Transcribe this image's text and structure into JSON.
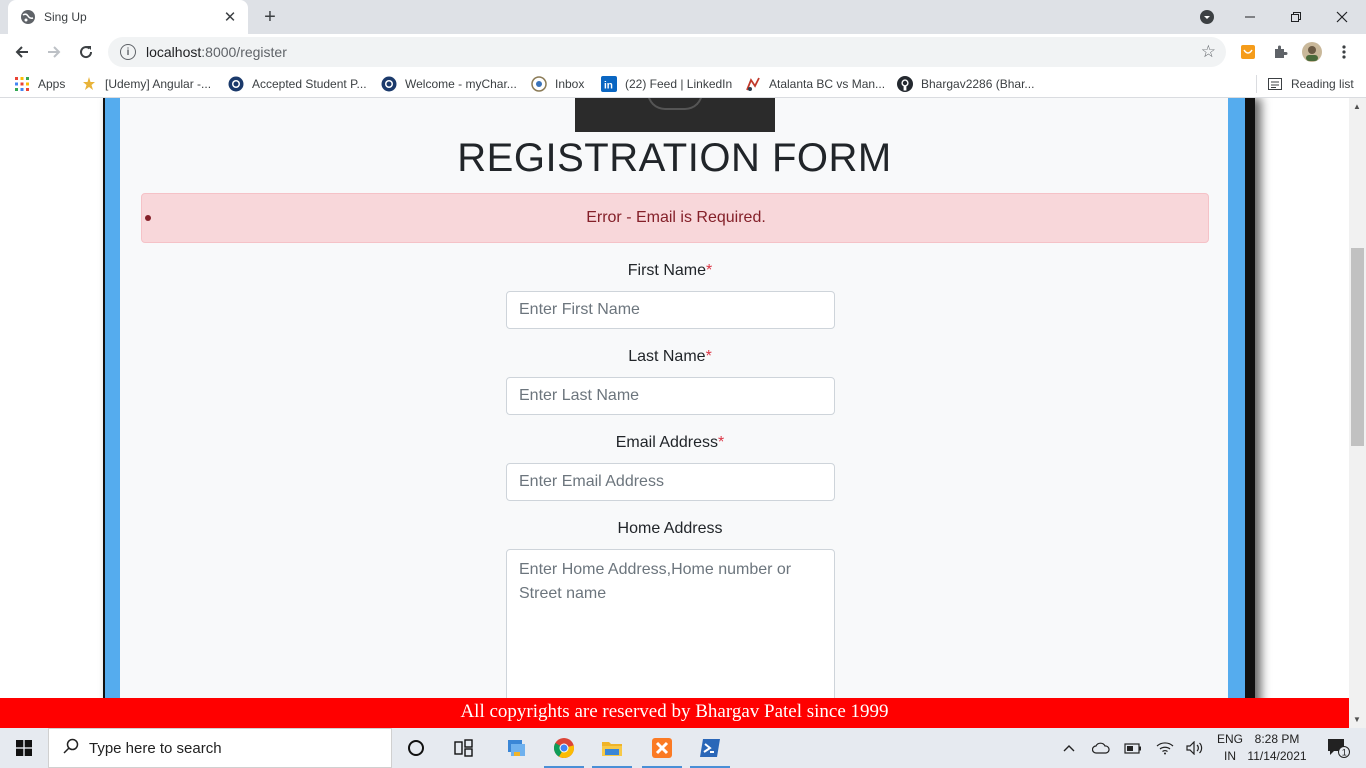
{
  "browser": {
    "tab_title": "Sing Up",
    "url_host": "localhost",
    "url_path": ":8000/register"
  },
  "bookmarks": [
    {
      "label": "Apps"
    },
    {
      "label": "[Udemy] Angular -..."
    },
    {
      "label": "Accepted Student P..."
    },
    {
      "label": "Welcome - myChar..."
    },
    {
      "label": "Inbox"
    },
    {
      "label": "(22) Feed | LinkedIn"
    },
    {
      "label": "Atalanta BC vs Man..."
    },
    {
      "label": "Bhargav2286 (Bhar..."
    }
  ],
  "reading_list": "Reading list",
  "page": {
    "title": "REGISTRATION FORM",
    "error": "Error - Email is Required.",
    "fields": {
      "first_name": {
        "label": "First Name",
        "required_mark": "*",
        "placeholder": "Enter First Name"
      },
      "last_name": {
        "label": "Last Name",
        "required_mark": "*",
        "placeholder": "Enter Last Name"
      },
      "email": {
        "label": "Email Address",
        "required_mark": "*",
        "placeholder": "Enter Email Address"
      },
      "home_address": {
        "label": "Home Address",
        "placeholder": "Enter Home Address,Home number or Street name"
      }
    },
    "footer": "All copyrights are reserved by Bhargav Patel since 1999"
  },
  "taskbar": {
    "search_placeholder": "Type here to search",
    "lang_top": "ENG",
    "lang_bottom": "IN",
    "time": "8:28 PM",
    "date": "11/14/2021",
    "notification_count": "1"
  },
  "colors": {
    "card_border": "#55acee",
    "error_bg": "#f8d7da",
    "error_text": "#842029",
    "footer_bg": "#ff0000"
  }
}
